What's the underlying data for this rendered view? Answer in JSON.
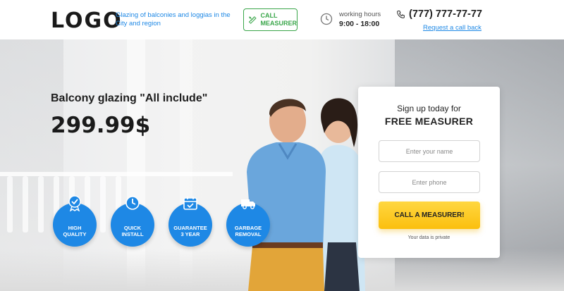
{
  "header": {
    "logo": "LOGO",
    "tagline": "Glazing of balconies and loggias in the City and region",
    "call_button": {
      "icon": "ruler-pencil-icon",
      "label_line1": "CALL",
      "label_line2": "MEASURER"
    },
    "hours": {
      "icon": "clock-icon",
      "label": "working hours",
      "value": "9:00 - 18:00"
    },
    "phone": {
      "icon": "phone-icon",
      "number": "(777) 777-77-77",
      "callback_link": "Request a call back"
    }
  },
  "hero": {
    "title": "Balcony glazing \"All include\"",
    "price": "299.99$",
    "features": [
      {
        "icon": "medal-icon",
        "line1": "HIGH",
        "line2": "QUALITY"
      },
      {
        "icon": "clock-icon",
        "line1": "QUICK",
        "line2": "INSTALL"
      },
      {
        "icon": "calendar-icon",
        "line1": "GUARANTEE",
        "line2": "3 YEAR"
      },
      {
        "icon": "truck-icon",
        "line1": "GARBAGE",
        "line2": "REMOVAL"
      }
    ]
  },
  "form": {
    "subtitle": "Sign up today for",
    "title": "FREE MEASURER",
    "name_placeholder": "Enter your name",
    "phone_placeholder": "Enter phone",
    "submit_label": "CALL A MEASURER!",
    "privacy_note": "Your data is private"
  },
  "colors": {
    "accent_blue": "#1e88e5",
    "accent_green": "#3aa64a",
    "cta_yellow": "#fbbf0e"
  }
}
